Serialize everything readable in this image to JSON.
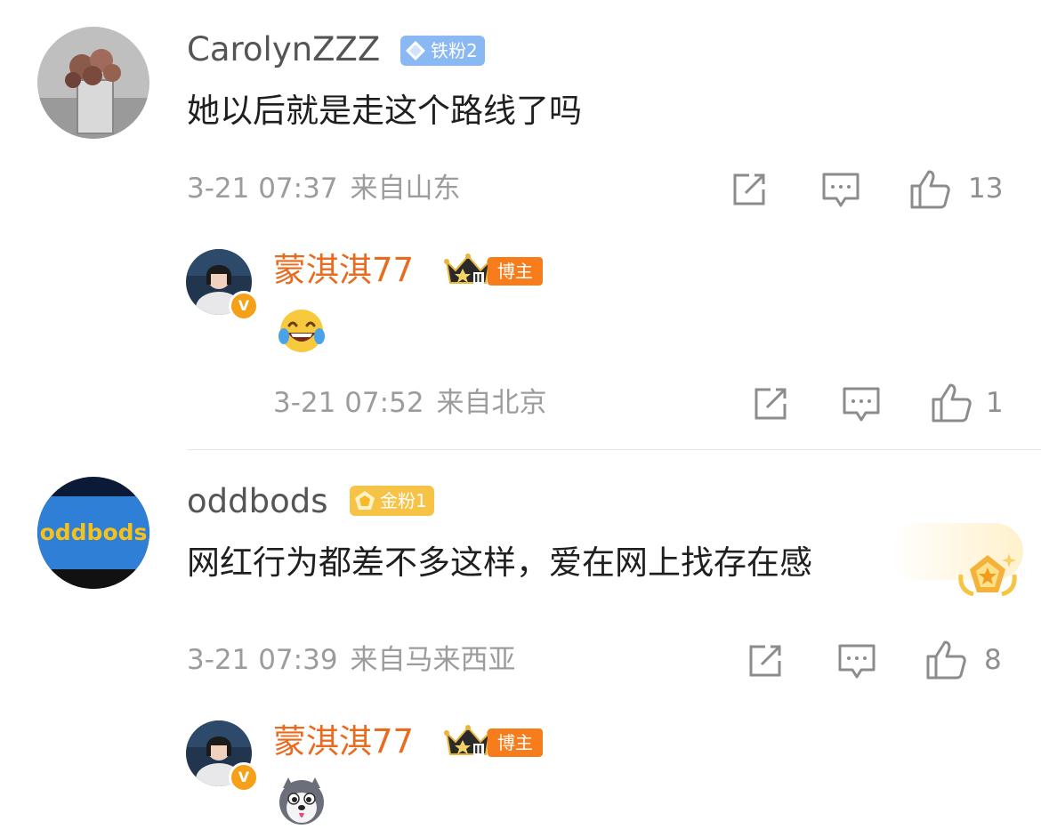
{
  "comments": [
    {
      "username": "CarolynZZZ",
      "fan_badge": "铁粉2",
      "text": "她以后就是走这个路线了吗",
      "date": "3-21 07:37",
      "location": "来自山东",
      "likes": "13",
      "reply": {
        "username": "蒙淇淇77",
        "role_tag": "博主",
        "crown_level": "II",
        "verified_mark": "V",
        "emoji": "laughing-tears-emoji",
        "date": "3-21 07:52",
        "location": "来自北京",
        "likes": "1"
      }
    },
    {
      "username": "oddbods",
      "fan_badge": "金粉1",
      "avatar_text": "oddbods",
      "text": "网红行为都差不多这样，爱在网上找存在感",
      "date": "3-21 07:39",
      "location": "来自马来西亚",
      "likes": "8",
      "reply": {
        "username": "蒙淇淇77",
        "role_tag": "博主",
        "crown_level": "II",
        "verified_mark": "V",
        "emoji": "husky-dog-emoji"
      }
    }
  ],
  "colors": {
    "username_gray": "#555555",
    "username_orange": "#e86b1f",
    "iron_badge": "#8ab8f2",
    "gold_badge": "#f7c347",
    "meta_gray": "#9c9c9c",
    "icon_gray": "#8c8c8c"
  }
}
